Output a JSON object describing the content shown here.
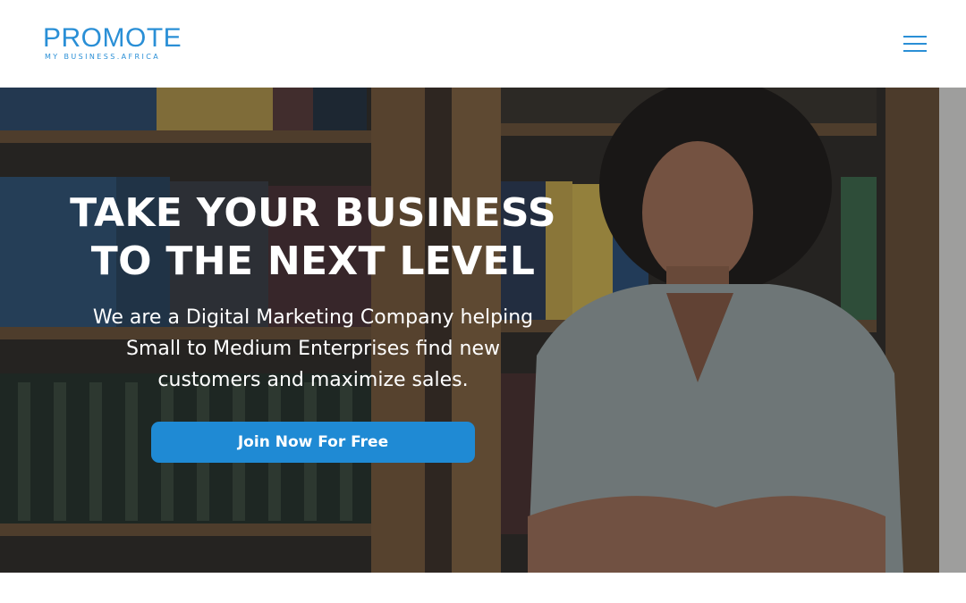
{
  "header": {
    "logo_main": "PROMOTE",
    "logo_sub": "MY BUSINESS.AFRICA",
    "menu_icon": "hamburger-menu-icon"
  },
  "hero": {
    "title_line1": "TAKE YOUR BUSINESS",
    "title_line2": "TO THE NEXT LEVEL",
    "subtitle_line1": "We are a Digital Marketing Company helping",
    "subtitle_line2": "Small to Medium Enterprises find new",
    "subtitle_line3": "customers and maximize sales.",
    "cta_label": "Join Now For Free",
    "image": "hero-photo-woman-bookshelves"
  },
  "colors": {
    "brand": "#2a8fd6",
    "cta": "#1f8ad4",
    "text_light": "#ffffff"
  }
}
